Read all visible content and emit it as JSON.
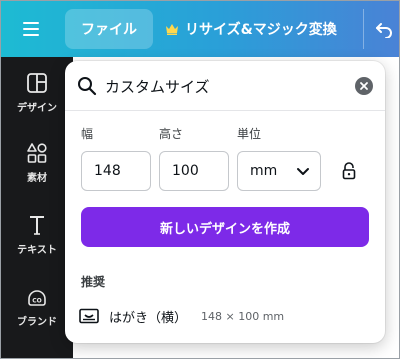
{
  "topbar": {
    "menu_icon": "hamburger-icon",
    "file_label": "ファイル",
    "resize_label": "リサイズ&マジック変換",
    "undo_icon": "undo-icon"
  },
  "sidebar": {
    "items": [
      {
        "label": "デザイン",
        "icon": "layout-icon"
      },
      {
        "label": "素材",
        "icon": "shapes-icon"
      },
      {
        "label": "テキスト",
        "icon": "text-icon"
      },
      {
        "label": "ブランド",
        "icon": "brand-icon"
      }
    ]
  },
  "panel": {
    "search": {
      "value": "カスタムサイズ"
    },
    "width": {
      "label": "幅",
      "value": "148"
    },
    "height": {
      "label": "高さ",
      "value": "100"
    },
    "unit": {
      "label": "単位",
      "value": "mm"
    },
    "create_label": "新しいデザインを作成",
    "recommended_label": "推奨",
    "suggestion": {
      "name": "はがき（横）",
      "size": "148 × 100 mm"
    }
  },
  "colors": {
    "accent": "#7d2ae8",
    "topbar_start": "#1dbbd3",
    "topbar_end": "#4a82d6",
    "sidebar": "#18191b"
  }
}
